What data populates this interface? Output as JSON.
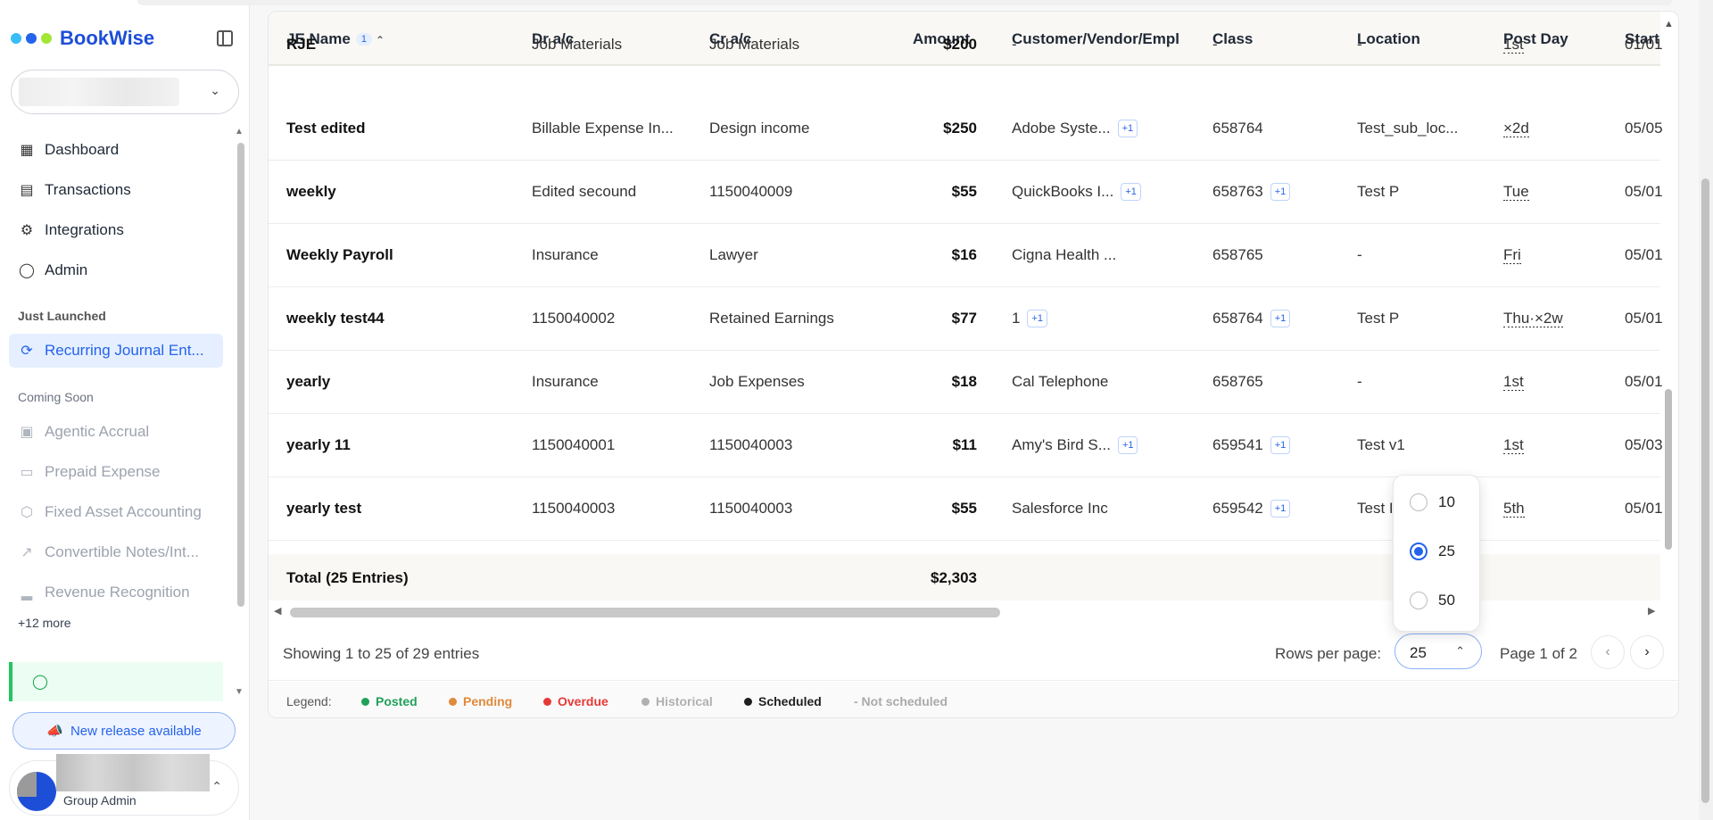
{
  "app": {
    "name": "BookWise"
  },
  "user": {
    "role": "Group Admin"
  },
  "sidebar": {
    "nav": [
      {
        "label": "Dashboard",
        "icon": "dashboard-icon"
      },
      {
        "label": "Transactions",
        "icon": "receipt-icon"
      },
      {
        "label": "Integrations",
        "icon": "gear-icon"
      },
      {
        "label": "Admin",
        "icon": "shield-icon"
      }
    ],
    "just_launched_label": "Just Launched",
    "active_item": "Recurring Journal Ent...",
    "coming_soon_label": "Coming Soon",
    "coming_soon": [
      "Agentic Accrual",
      "Prepaid Expense",
      "Fixed Asset Accounting",
      "Convertible Notes/Int...",
      "Revenue Recognition"
    ],
    "more_link": "+12 more",
    "release_button": "New release available"
  },
  "table": {
    "headers": {
      "je_name": "JE Name",
      "sort_count": "1",
      "dr": "Dr a/c",
      "cr": "Cr a/c",
      "amount": "Amount",
      "customer": "Customer/Vendor/Empl",
      "class": "Class",
      "location": "Location",
      "post_day": "Post Day",
      "start": "Start"
    },
    "rows": [
      {
        "name": "RJE",
        "dr": "Job Materials",
        "cr": "Job Materials",
        "amount": "$200",
        "customer": "-",
        "cust_more": "",
        "class": "-",
        "class_more": "",
        "location": "-",
        "post_day": "1st",
        "start": "01/01"
      },
      {
        "name": "Test edited",
        "dr": "Billable Expense In...",
        "cr": "Design income",
        "amount": "$250",
        "customer": "Adobe Syste...",
        "cust_more": "+1",
        "class": "658764",
        "class_more": "",
        "location": "Test_sub_loc...",
        "post_day": "×2d",
        "start": "05/05"
      },
      {
        "name": "weekly",
        "dr": "Edited secound",
        "cr": "1150040009",
        "amount": "$55",
        "customer": "QuickBooks I...",
        "cust_more": "+1",
        "class": "658763",
        "class_more": "+1",
        "location": "Test P",
        "post_day": "Tue",
        "start": "05/01"
      },
      {
        "name": "Weekly Payroll",
        "dr": "Insurance",
        "cr": "Lawyer",
        "amount": "$16",
        "customer": "Cigna Health ...",
        "cust_more": "",
        "class": "658765",
        "class_more": "",
        "location": "-",
        "post_day": "Fri",
        "start": "05/01"
      },
      {
        "name": "weekly test44",
        "dr": "1150040002",
        "cr": "Retained Earnings",
        "amount": "$77",
        "customer": "1",
        "cust_more": "+1",
        "class": "658764",
        "class_more": "+1",
        "location": "Test P",
        "post_day": "Thu·×2w",
        "start": "05/01"
      },
      {
        "name": "yearly",
        "dr": "Insurance",
        "cr": "Job Expenses",
        "amount": "$18",
        "customer": "Cal Telephone",
        "cust_more": "",
        "class": "658765",
        "class_more": "",
        "location": "-",
        "post_day": "1st",
        "start": "05/01"
      },
      {
        "name": "yearly 11",
        "dr": "1150040001",
        "cr": "1150040003",
        "amount": "$11",
        "customer": "Amy's Bird S...",
        "cust_more": "+1",
        "class": "659541",
        "class_more": "+1",
        "location": "Test v1",
        "post_day": "1st",
        "start": "05/03"
      },
      {
        "name": "yearly test",
        "dr": "1150040003",
        "cr": "1150040003",
        "amount": "$55",
        "customer": "Salesforce Inc",
        "cust_more": "",
        "class": "659542",
        "class_more": "+1",
        "location": "Test I",
        "post_day": "5th",
        "start": "05/01"
      }
    ],
    "total_label": "Total (25 Entries)",
    "total_amount": "$2,303"
  },
  "pagination": {
    "showing": "Showing 1 to 25 of 29 entries",
    "rows_per_page_label": "Rows per page:",
    "rows_per_page_value": "25",
    "options": [
      "10",
      "25",
      "50"
    ],
    "selected_option": "25",
    "page_info": "Page 1 of 2"
  },
  "legend": {
    "label": "Legend:",
    "items": [
      {
        "label": "Posted",
        "color": "#22a05a"
      },
      {
        "label": "Pending",
        "color": "#e08a3c"
      },
      {
        "label": "Overdue",
        "color": "#e53935"
      },
      {
        "label": "Historical",
        "color": "#b0b0b0"
      },
      {
        "label": "Scheduled",
        "color": "#1f1f1f"
      }
    ],
    "not_scheduled": "- Not scheduled"
  },
  "colors": {
    "accent": "#2563eb"
  }
}
